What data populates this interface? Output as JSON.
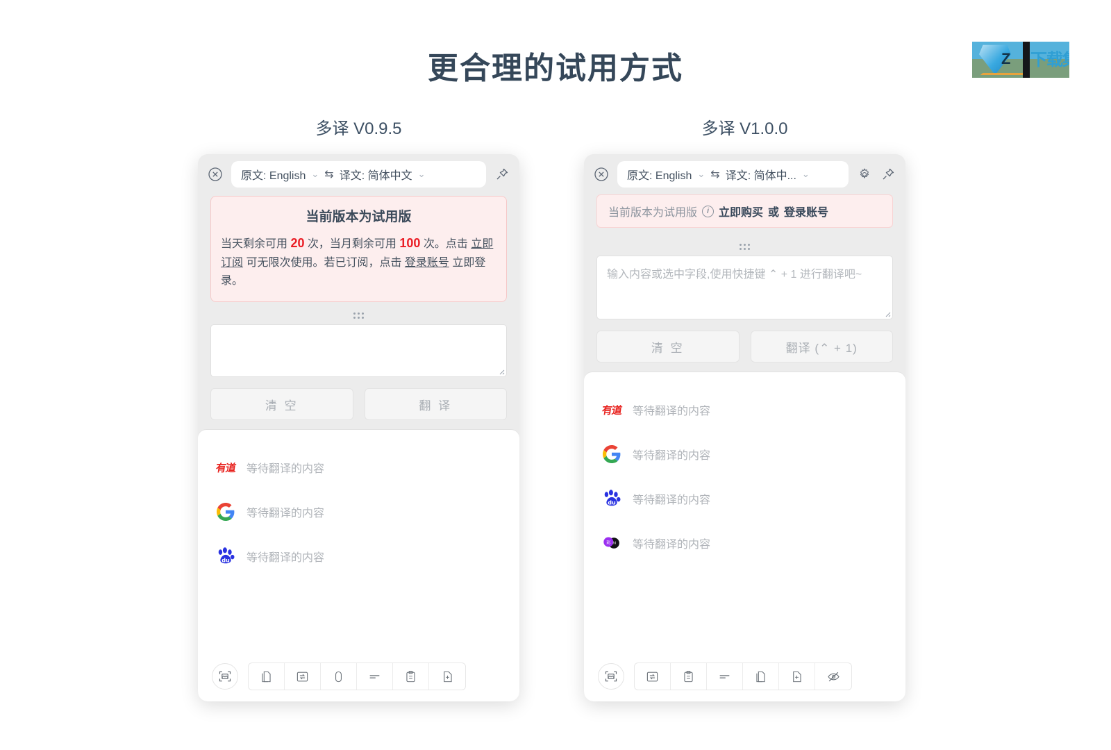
{
  "page": {
    "title": "更合理的试用方式",
    "background": "#ffffff",
    "title_color": "#354759"
  },
  "watermark": {
    "text": "下载集",
    "mark": "Z"
  },
  "panels": [
    {
      "caption": "多译 V0.9.5",
      "header": {
        "close_icon": "close-circle-icon",
        "source_label": "原文: English",
        "swap_icon": "swap-arrow-icon",
        "target_label": "译文: 简体中文",
        "caret": "⌄",
        "pin_icon": "pin-icon",
        "has_settings": false
      },
      "notice": {
        "style": "box",
        "title": "当前版本为试用版",
        "segments": [
          {
            "text": "当天剩余可用 ",
            "kind": "plain"
          },
          {
            "text": "20",
            "kind": "number",
            "color": "#ea1c24"
          },
          {
            "text": " 次，当月剩余可用 ",
            "kind": "plain"
          },
          {
            "text": "100",
            "kind": "number",
            "color": "#ea1c24"
          },
          {
            "text": " 次。点击 ",
            "kind": "plain"
          },
          {
            "text": "立即订阅",
            "kind": "link"
          },
          {
            "text": " 可无限次使用。若已订阅，点击 ",
            "kind": "plain"
          },
          {
            "text": "登录账号",
            "kind": "link"
          },
          {
            "text": " 立即登录。",
            "kind": "plain"
          }
        ]
      },
      "input": {
        "value": "",
        "placeholder": ""
      },
      "buttons": {
        "clear": "清 空",
        "translate": "翻 译"
      },
      "results": [
        {
          "engine": "youdao",
          "logo_text": "有道",
          "text": "等待翻译的内容"
        },
        {
          "engine": "google",
          "logo_text": "G",
          "text": "等待翻译的内容"
        },
        {
          "engine": "baidu",
          "logo_text": "du",
          "text": "等待翻译的内容"
        }
      ],
      "toolbar": {
        "screenshot_icon": "screenshot-icon",
        "tools": [
          "copy-document-icon",
          "refresh-box-icon",
          "mouse-icon",
          "text-lines-icon",
          "clipboard-icon",
          "document-plus-icon"
        ]
      }
    },
    {
      "caption": "多译 V1.0.0",
      "header": {
        "close_icon": "close-circle-icon",
        "source_label": "原文:  English",
        "swap_icon": "swap-arrow-icon",
        "target_label": "译文:  简体中...",
        "caret": "⌄",
        "settings_icon": "gear-icon",
        "pin_icon": "pin-icon",
        "has_settings": true
      },
      "notice": {
        "style": "bar",
        "prefix": "当前版本为试用版",
        "info_icon": "info-icon",
        "buy": "立即购买",
        "or": "或",
        "login": "登录账号"
      },
      "input": {
        "value": "",
        "placeholder": "输入内容或选中字段,使用快捷键 ⌃ + 1 进行翻译吧~"
      },
      "buttons": {
        "clear": "清 空",
        "translate": "翻译 (⌃ + 1)"
      },
      "results": [
        {
          "engine": "youdao",
          "logo_text": "有道",
          "text": "等待翻译的内容"
        },
        {
          "engine": "google",
          "logo_text": "G",
          "text": "等待翻译的内容"
        },
        {
          "engine": "baidu",
          "logo_text": "du",
          "text": "等待翻译的内容"
        },
        {
          "engine": "caiyun",
          "logo_text": "",
          "text": "等待翻译的内容"
        }
      ],
      "toolbar": {
        "screenshot_icon": "screenshot-icon",
        "tools": [
          "refresh-box-icon",
          "clipboard-icon",
          "text-lines-icon",
          "copy-document-icon",
          "document-plus-icon",
          "eye-slash-icon"
        ]
      }
    }
  ]
}
